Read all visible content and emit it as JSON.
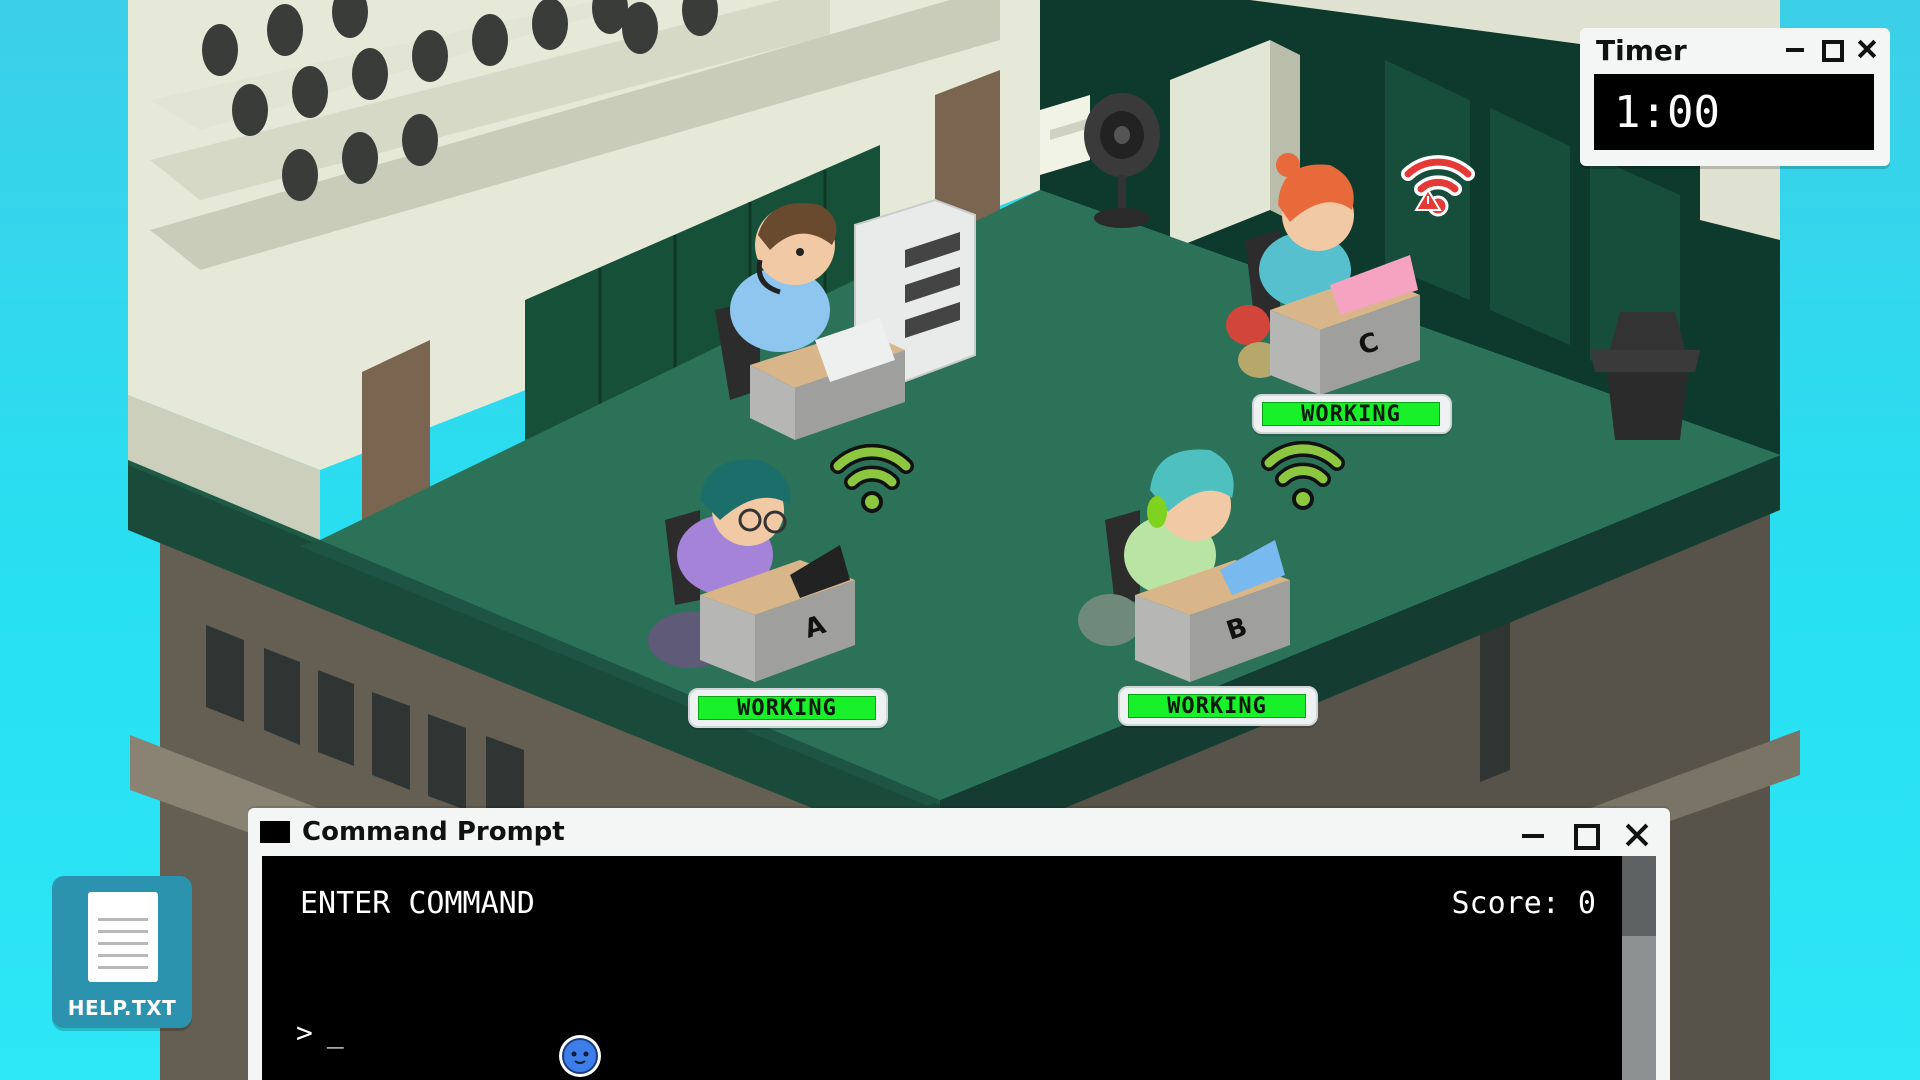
{
  "timer": {
    "title": "Timer",
    "time": "1:00"
  },
  "stations": [
    {
      "desk_label": "A",
      "status": "WORKING",
      "wifi": "ok"
    },
    {
      "desk_label": "B",
      "status": "WORKING",
      "wifi": "ok"
    },
    {
      "desk_label": "C",
      "status": "WORKING",
      "wifi": "warning"
    }
  ],
  "command_prompt": {
    "title": "Command Prompt",
    "heading": "ENTER COMMAND",
    "score": "Score: 0",
    "prompt_symbol": ">",
    "input_value": "_"
  },
  "help_file": {
    "label": "HELP.TXT"
  },
  "colors": {
    "sky": "#2de0f2",
    "floor": "#2c7258",
    "wall": "#e6e9d8",
    "status_green": "#18f02a",
    "wifi_ok": "#8dc63f",
    "wifi_warning": "#e53935",
    "help_icon_bg": "#2b93ad"
  },
  "icons": [
    "wifi-icon",
    "wifi-warning-icon",
    "document-icon",
    "terminal-icon",
    "minimize-icon",
    "maximize-icon",
    "close-icon"
  ]
}
